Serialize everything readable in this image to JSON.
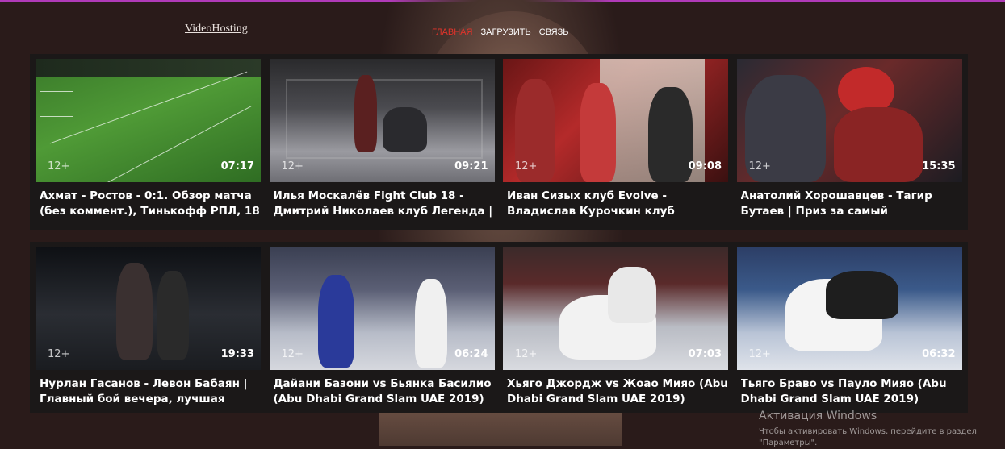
{
  "header": {
    "logo": "VideoHosting",
    "nav": [
      "ГЛАВНАЯ",
      "ЗАГРУЗИТЬ",
      "СВЯЗЬ"
    ]
  },
  "colors": {
    "accent": "#e0342b",
    "page_bg": "#2a1b1a",
    "grid_bg": "#1b1818",
    "top_line": "#b03ab8"
  },
  "videos": [
    {
      "title": "Ахмат - Ростов - 0:1. Обзор матча (без коммент.), Тинькофф РПЛ, 18",
      "age": "12+",
      "duration": "07:17"
    },
    {
      "title": "Илья Москалёв Fight Club 18 - Дмитрий Николаев клуб Легенда |",
      "age": "12+",
      "duration": "09:21"
    },
    {
      "title": "Иван Сизых клуб Evolve - Владислав Курочкин клуб Золотой",
      "age": "12+",
      "duration": "09:08"
    },
    {
      "title": "Анатолий Хорошавцев - Тагир Бутаев | Приз за самый",
      "age": "12+",
      "duration": "15:35"
    },
    {
      "title": "Нурлан Гасанов - Левон Бабаян | Главный бой вечера, лучшая",
      "age": "12+",
      "duration": "19:33"
    },
    {
      "title": "Дайани Базони vs Бьянка Басилио (Abu Dhabi Grand Slam UAE 2019)",
      "age": "12+",
      "duration": "06:24"
    },
    {
      "title": "Хьяго Джордж vs Жоао Мияо (Abu Dhabi Grand Slam UAE 2019)",
      "age": "12+",
      "duration": "07:03"
    },
    {
      "title": "Тьяго Браво vs Пауло Мияо (Abu Dhabi Grand Slam UAE 2019)",
      "age": "12+",
      "duration": "06:32"
    }
  ],
  "activation": {
    "title": "Активация Windows",
    "line1": "Чтобы активировать Windows, перейдите в раздел",
    "line2": "\"Параметры\"."
  }
}
